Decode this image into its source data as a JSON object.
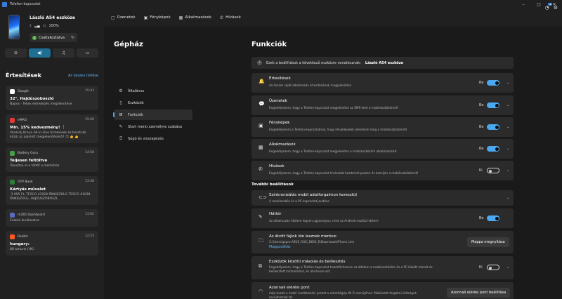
{
  "window": {
    "title": "Telefon-kapcsolat",
    "controls": [
      "–",
      "□",
      "✕"
    ]
  },
  "device": {
    "name": "László A54 eszköze",
    "battery": "100%",
    "connection_label": "Csatlakoztatva"
  },
  "quick_actions": [
    {
      "icon": "do-not-disturb-icon",
      "glyph": "⊖",
      "active": false
    },
    {
      "icon": "volume-icon",
      "glyph": "◀)",
      "active": true
    },
    {
      "icon": "music-icon",
      "glyph": "♫",
      "active": false
    },
    {
      "icon": "video-icon",
      "glyph": "▭",
      "active": false
    }
  ],
  "notifications": {
    "header": "Értesítések",
    "clear_all": "Az összes törlése",
    "items": [
      {
        "app": "Google",
        "app_color": "#ffffff",
        "time": "15:43",
        "title": "32°, Hajdúszoboszló",
        "body": "Napos · Teljes előrejelzés megtekintése"
      },
      {
        "app": "eMAG",
        "app_color": "#e53935",
        "time": "15:06",
        "title": "Min. 15% kedvezmény! ❗",
        "body": "Vásárolj Braun All-in-One trimmerek és borotvák közül az ajánlott megjelenítéséről! 😊 👍 👍"
      },
      {
        "app": "Battery Guru",
        "app_color": "#43a047",
        "time": "14:58",
        "title": "Teljesen feltöltve",
        "body": "Távolítsa el a töltőt a méréshez"
      },
      {
        "app": "OTP Bank",
        "app_color": "#2e7d32",
        "time": "13:48",
        "title": "Kártyás művelet",
        "body": "-3 995 Ft, TESCO 41028 ÖNKISZOLG TESCO 41028 ÖNKISZOLG, HAJDUSZOBOSZL"
      },
      {
        "app": "m365 Dashboard",
        "app_color": "#5c6bc0",
        "time": "13:02",
        "title": "",
        "body": "Eszköz leválasztva"
      },
      {
        "app": "Reddit",
        "app_color": "#ff5722",
        "time": "12:53",
        "title": "hungary:",
        "body": "88 tartunk (HK)"
      }
    ]
  },
  "nav_tabs": [
    {
      "label": "Üzenetek",
      "icon": "message-icon",
      "glyph": "▢"
    },
    {
      "label": "Fényképek",
      "icon": "photo-icon",
      "glyph": "▣"
    },
    {
      "label": "Alkalmazások",
      "icon": "apps-icon",
      "glyph": "▦"
    },
    {
      "label": "Hívások",
      "icon": "phone-icon",
      "glyph": "✆"
    }
  ],
  "nav_right": {
    "notification_badge": "1"
  },
  "settings_nav": {
    "title": "Gépház",
    "items": [
      {
        "label": "Általános",
        "icon": "gear-icon",
        "glyph": "⚙"
      },
      {
        "label": "Eszközök",
        "icon": "device-icon",
        "glyph": "▯"
      },
      {
        "label": "Funkciók",
        "icon": "features-icon",
        "glyph": "⊞"
      },
      {
        "label": "Start menü személyre szabása",
        "icon": "pin-icon",
        "glyph": "✎"
      },
      {
        "label": "Súgó és visszajelzés",
        "icon": "help-icon",
        "glyph": "⍰"
      }
    ]
  },
  "content": {
    "title": "Funkciók",
    "info_text": "Ezek a beállítások a következő eszközre vonatkoznak:",
    "info_device": "László A54 eszköze",
    "features": [
      {
        "title": "Értesítések",
        "desc": "Az összes saját alkalmazás értesítésének megjelenítése",
        "state": "Be",
        "on": true,
        "icon": "bell-icon",
        "glyph": "🔔"
      },
      {
        "title": "Üzenetek",
        "desc": "Engedélyezem, hogy a Telefon-kapcsolat megjelenítse az SMS-eket a mobileszközömről",
        "state": "Be",
        "on": true,
        "icon": "chat-icon",
        "glyph": "💬"
      },
      {
        "title": "Fényképek",
        "desc": "Engedélyezem a Telefon-kapcsolatnak, hogy Fényképeket jelenítsen meg a mobileszközömről",
        "state": "Be",
        "on": true,
        "icon": "photo-icon",
        "glyph": "▣"
      },
      {
        "title": "Alkalmazások",
        "desc": "Engedélyezem, hogy a Telefon-kapcsolat megjelenítse a mobileszközöm alkalmazásait",
        "state": "Be",
        "on": true,
        "icon": "apps-icon",
        "glyph": "▦"
      },
      {
        "title": "Hívások",
        "desc": "Engedélyezem, hogy a Telefon-kapcsolat hívásokat kezdeményezzen és kezeljen a mobileszközömről",
        "state": "Ki",
        "on": false,
        "icon": "phone-icon",
        "glyph": "✆"
      }
    ],
    "more_label": "További beállítások",
    "sync": {
      "title": "Szinkronizálás mobil adatforgalmon keresztül",
      "desc": "A mobileszköz és a PC-kapcsolat jevítése"
    },
    "wallpaper": {
      "title": "Háttér",
      "desc": "Az alkalmazás háttere legyen ugyanolyan, mint az Android-eszköz háttere",
      "state": "Be"
    },
    "transfer": {
      "title": "Az átvitt fájlok ide lesznek mentve:",
      "path": "C:\\Users\\gspro.ASUS_ROG_B650_E\\Downloads\\Phone Link",
      "link": "Mappaváltás",
      "button": "Mappa megnyitása"
    },
    "clipboard": {
      "title": "Eszközök közötti másolás és beillesztés",
      "desc": "Engedélyezem, hogy a Telefon-kapcsolat hozzáférhessen az általam a mobileszközöm és a PC között másolt és beillesztett tartalomhoz, és átvihesse ezt.",
      "state": "Ki"
    },
    "hotspot": {
      "title": "Azonnali elérési pont",
      "desc": "Adja hozzá a mobil csatlakozási pontot a számítógép Wi-Fi menüjéhez. Mobiladat-forgalmi költségek merülhetnek fel.",
      "button": "Azonnali elérési pont beállítása"
    }
  }
}
